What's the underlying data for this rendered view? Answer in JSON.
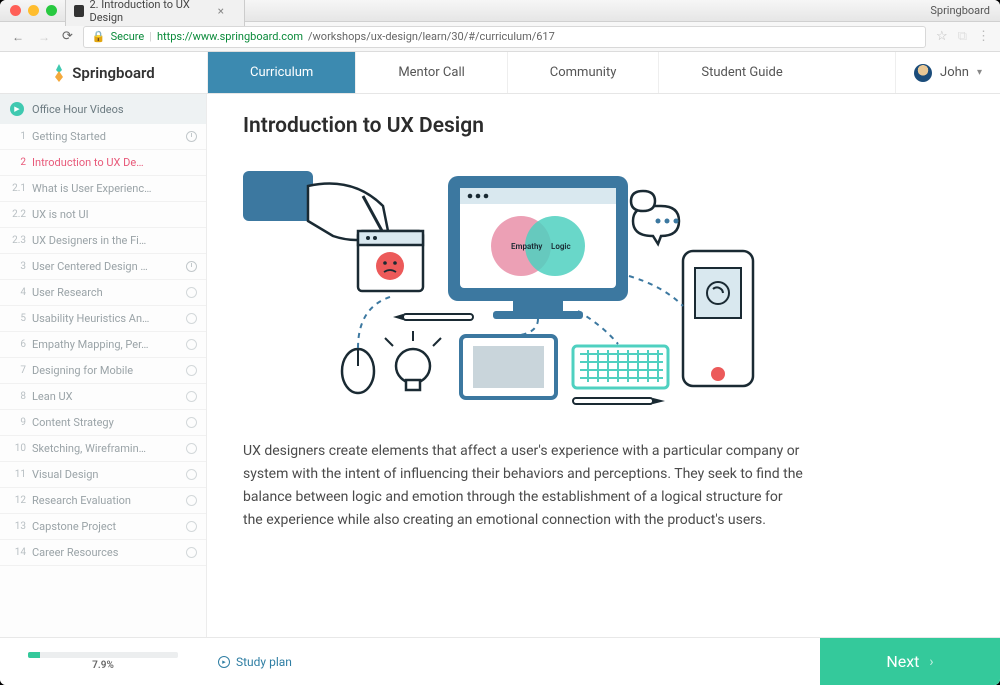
{
  "browser": {
    "tab_title": "2. Introduction to UX Design",
    "app_name": "Springboard",
    "secure_label": "Secure",
    "url_host": "https://www.springboard.com",
    "url_path": "/workshops/ux-design/learn/30/#/curriculum/617"
  },
  "brand": "Springboard",
  "nav": {
    "items": [
      "Curriculum",
      "Mentor Call",
      "Community",
      "Student Guide"
    ],
    "active_index": 0
  },
  "user": {
    "name": "John"
  },
  "sidebar": {
    "header": "Office Hour Videos",
    "items": [
      {
        "num": "1",
        "label": "Getting Started",
        "status": "clock",
        "active": false
      },
      {
        "num": "2",
        "label": "Introduction to UX De…",
        "status": "none",
        "active": true
      },
      {
        "num": "2.1",
        "label": "What is User Experienc…",
        "status": "none",
        "active": false
      },
      {
        "num": "2.2",
        "label": "UX is not UI",
        "status": "none",
        "active": false
      },
      {
        "num": "2.3",
        "label": "UX Designers in the Fi…",
        "status": "none",
        "active": false
      },
      {
        "num": "3",
        "label": "User Centered Design …",
        "status": "clock",
        "active": false
      },
      {
        "num": "4",
        "label": "User Research",
        "status": "circle",
        "active": false
      },
      {
        "num": "5",
        "label": "Usability Heuristics An…",
        "status": "circle",
        "active": false
      },
      {
        "num": "6",
        "label": "Empathy Mapping, Per…",
        "status": "circle",
        "active": false
      },
      {
        "num": "7",
        "label": "Designing for Mobile",
        "status": "circle",
        "active": false
      },
      {
        "num": "8",
        "label": "Lean UX",
        "status": "circle",
        "active": false
      },
      {
        "num": "9",
        "label": "Content Strategy",
        "status": "circle",
        "active": false
      },
      {
        "num": "10",
        "label": "Sketching, Wireframin…",
        "status": "circle",
        "active": false
      },
      {
        "num": "11",
        "label": "Visual Design",
        "status": "circle",
        "active": false
      },
      {
        "num": "12",
        "label": "Research Evaluation",
        "status": "circle",
        "active": false
      },
      {
        "num": "13",
        "label": "Capstone Project",
        "status": "circle",
        "active": false
      },
      {
        "num": "14",
        "label": "Career Resources",
        "status": "circle",
        "active": false
      }
    ]
  },
  "content": {
    "title": "Introduction to UX Design",
    "illustration": {
      "venn_left": "Empathy",
      "venn_right": "Logic"
    },
    "body": "UX designers create elements that affect a user's experience with a particular company or system with the intent of influencing their behaviors and perceptions. They seek to find the balance between logic and emotion through the establishment of a logical structure for the experience while also creating an emotional connection with the product's users."
  },
  "footer": {
    "progress_percent": 7.9,
    "progress_label": "7.9%",
    "study_plan": "Study plan",
    "next_label": "Next"
  }
}
